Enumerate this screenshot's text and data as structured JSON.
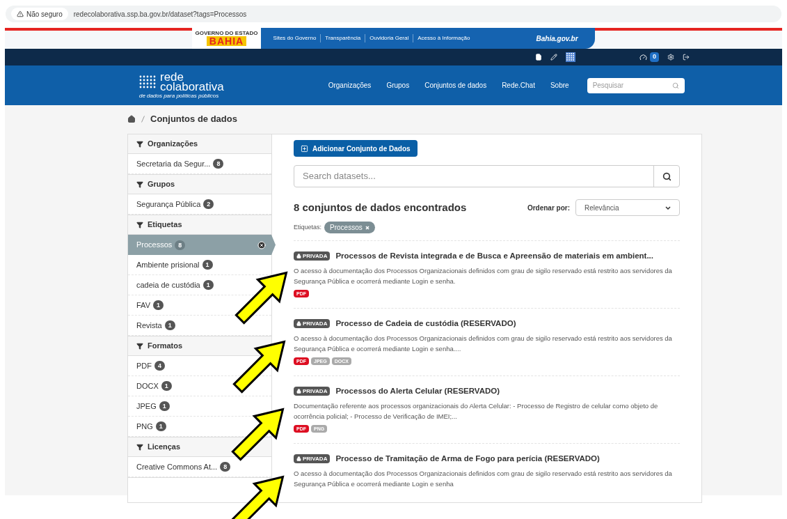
{
  "browser": {
    "security": "Não seguro",
    "url": "redecolaborativa.ssp.ba.gov.br/dataset?tags=Processos"
  },
  "gov_bar": {
    "logo_top": "GOVERNO DO ESTADO",
    "logo_word": "BAHIA",
    "links": [
      "Sites do Governo",
      "Transparência",
      "Ouvidoria Geral",
      "Acesso à Informação"
    ],
    "portal": "Bahia.gov.br"
  },
  "account_bar": {
    "dashboard_count": "0"
  },
  "header": {
    "logo_line1": "rede",
    "logo_line2": "colaborativa",
    "tagline": "de dados para políticas públicos",
    "nav": [
      "Organizações",
      "Grupos",
      "Conjuntos de dados",
      "Rede.Chat",
      "Sobre"
    ],
    "search": {
      "placeholder": "Pesquisar"
    }
  },
  "breadcrumb": [
    "Conjuntos de dados"
  ],
  "facets": [
    {
      "title": "Organizações",
      "items": [
        {
          "label": "Secretaria da Segur...",
          "count": "8",
          "selected": false
        }
      ]
    },
    {
      "title": "Grupos",
      "items": [
        {
          "label": "Segurança Pública",
          "count": "2",
          "selected": false
        }
      ]
    },
    {
      "title": "Etiquetas",
      "items": [
        {
          "label": "Processos",
          "count": "8",
          "selected": true
        },
        {
          "label": "Ambiente prisional",
          "count": "1",
          "selected": false
        },
        {
          "label": "cadeia de custódia",
          "count": "1",
          "selected": false
        },
        {
          "label": "FAV",
          "count": "1",
          "selected": false
        },
        {
          "label": "Revista",
          "count": "1",
          "selected": false
        }
      ]
    },
    {
      "title": "Formatos",
      "items": [
        {
          "label": "PDF",
          "count": "4",
          "selected": false
        },
        {
          "label": "DOCX",
          "count": "1",
          "selected": false
        },
        {
          "label": "JPEG",
          "count": "1",
          "selected": false
        },
        {
          "label": "PNG",
          "count": "1",
          "selected": false
        }
      ]
    },
    {
      "title": "Licenças",
      "items": [
        {
          "label": "Creative Commons At...",
          "count": "8",
          "selected": false
        }
      ]
    }
  ],
  "add_button": "Adicionar Conjunto de Dados",
  "dataset_search": {
    "placeholder": "Search datasets..."
  },
  "results_heading": "8 conjuntos de dados encontrados",
  "sort": {
    "label": "Ordenar por:",
    "value": "Relevância"
  },
  "active_filters": {
    "label": "Etiquetas:",
    "tags": [
      "Processos"
    ]
  },
  "datasets": [
    {
      "badge": "PRIVADA",
      "title": "Processos de Revista integrada e de Busca e Apreensão de materiais em ambient...",
      "description": "O acesso à documentação dos Processos Organizacionais definidos com grau de sigilo reservado está restrito aos servidores da Segurança Pública e ocorrerá mediante Login e senha.",
      "formats": [
        {
          "label": "PDF",
          "color": "#dd0e22"
        }
      ]
    },
    {
      "badge": "PRIVADA",
      "title": "Processo de Cadeia de custódia (RESERVADO)",
      "description": "O acesso à documentação dos Processos Organizacionais definidos com grau de sigilo reservado está restrito aos servidores da Segurança Pública e ocorrerá mediante Login e senha....",
      "formats": [
        {
          "label": "PDF",
          "color": "#dd0e22"
        },
        {
          "label": "JPEG",
          "color": "#aaaaaa"
        },
        {
          "label": "DOCX",
          "color": "#aaaaaa"
        }
      ]
    },
    {
      "badge": "PRIVADA",
      "title": "Processos do Alerta Celular (RESERVADO)",
      "description": "Documentação referente aos processos organizacionais do Alerta Celular: - Processo de Registro de celular como objeto de ocorrência policial; - Processo de Verificação de IMEI;...",
      "formats": [
        {
          "label": "PDF",
          "color": "#dd0e22"
        },
        {
          "label": "PNG",
          "color": "#aaaaaa"
        }
      ]
    },
    {
      "badge": "PRIVADA",
      "title": "Processo de Tramitação de Arma de Fogo para perícia (RESERVADO)",
      "description": "O acesso à documentação dos Processos Organizacionais definidos com grau de sigilo reservado está restrito aos servidores da Segurança Pública e ocorrerá mediante Login e senha"
    }
  ]
}
